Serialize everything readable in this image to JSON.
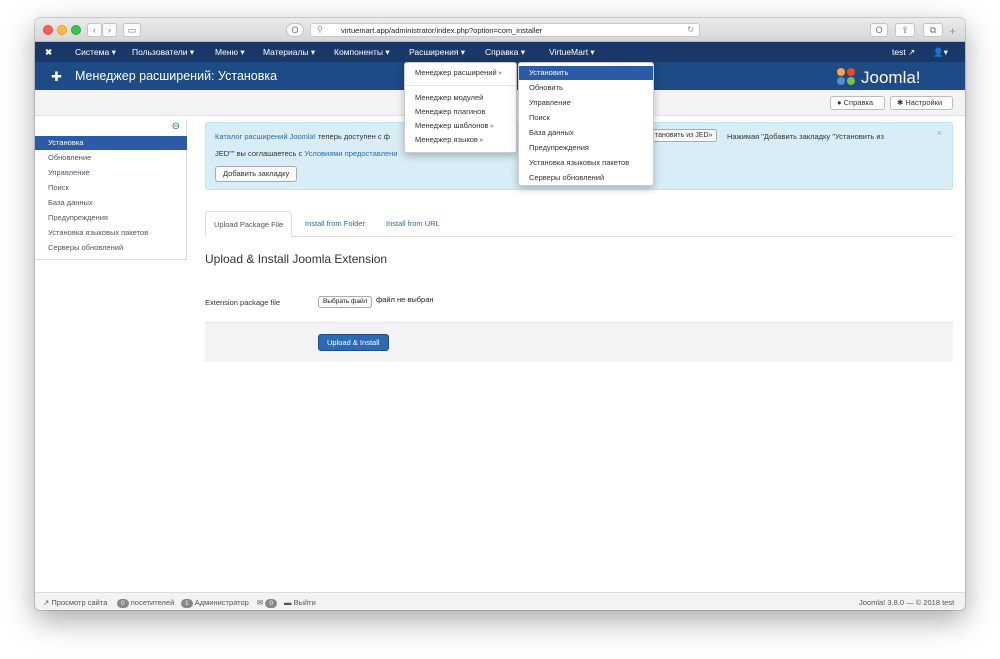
{
  "browser": {
    "url": "virtuemart.app/administrator/index.php?option=com_installer"
  },
  "nav": {
    "items": [
      "Система ▾",
      "Пользователи ▾",
      "Меню ▾",
      "Материалы ▾",
      "Компоненты ▾",
      "Расширения ▾",
      "Справка ▾",
      "VirtueMart ▾"
    ],
    "user": "test",
    "colors": {
      "nav_bg": "#1a3867",
      "header_bg": "#1e4a85"
    }
  },
  "header": {
    "title": "Менеджер расширений: Установка",
    "logo_text": "Joomla!"
  },
  "toolbar": {
    "help_label": "Справка",
    "options_label": "Настройки"
  },
  "sidebar": {
    "items": [
      "Установка",
      "Обновление",
      "Управление",
      "Поиск",
      "База данных",
      "Предупреждения",
      "Установка языковых пакетов",
      "Серверы обновлений"
    ],
    "active_index": 0
  },
  "alert": {
    "link1": "Каталог расширений Joomla!",
    "text1": "теперь доступен с ф",
    "button_partial": "тановить из JED»",
    "text2": "Нажимая \"Добавить закладку \"Установить из",
    "line2a": "JED\"\" вы соглашаетесь с",
    "link2": "Условиями предоставлени",
    "add_bookmark": "Добавить закладку"
  },
  "tabs": [
    "Upload Package File",
    "Install from Folder",
    "Install from URL"
  ],
  "form": {
    "heading": "Upload & Install Joomla Extension",
    "label": "Extension package file",
    "file_button": "Выбрать файл",
    "file_status": "файл не выбран",
    "submit": "Upload & Install"
  },
  "menu_extensions": {
    "items": [
      "Менеджер расширений",
      "Менеджер модулей",
      "Менеджер плагинов",
      "Менеджер шаблонов",
      "Менеджер языков"
    ]
  },
  "submenu": {
    "items": [
      "Установить",
      "Обновить",
      "Управление",
      "Поиск",
      "База данных",
      "Предупреждения",
      "Установка языковых пакетов",
      "Серверы обновлений"
    ]
  },
  "footer": {
    "view_site": "Просмотр сайта",
    "visitors_count": "0",
    "visitors_label": "посетителей",
    "admins_count": "1",
    "admins_label": "Администратор",
    "messages_count": "0",
    "logout": "Выйти",
    "version": "Joomla! 3.8.0 — © 2018 test"
  }
}
